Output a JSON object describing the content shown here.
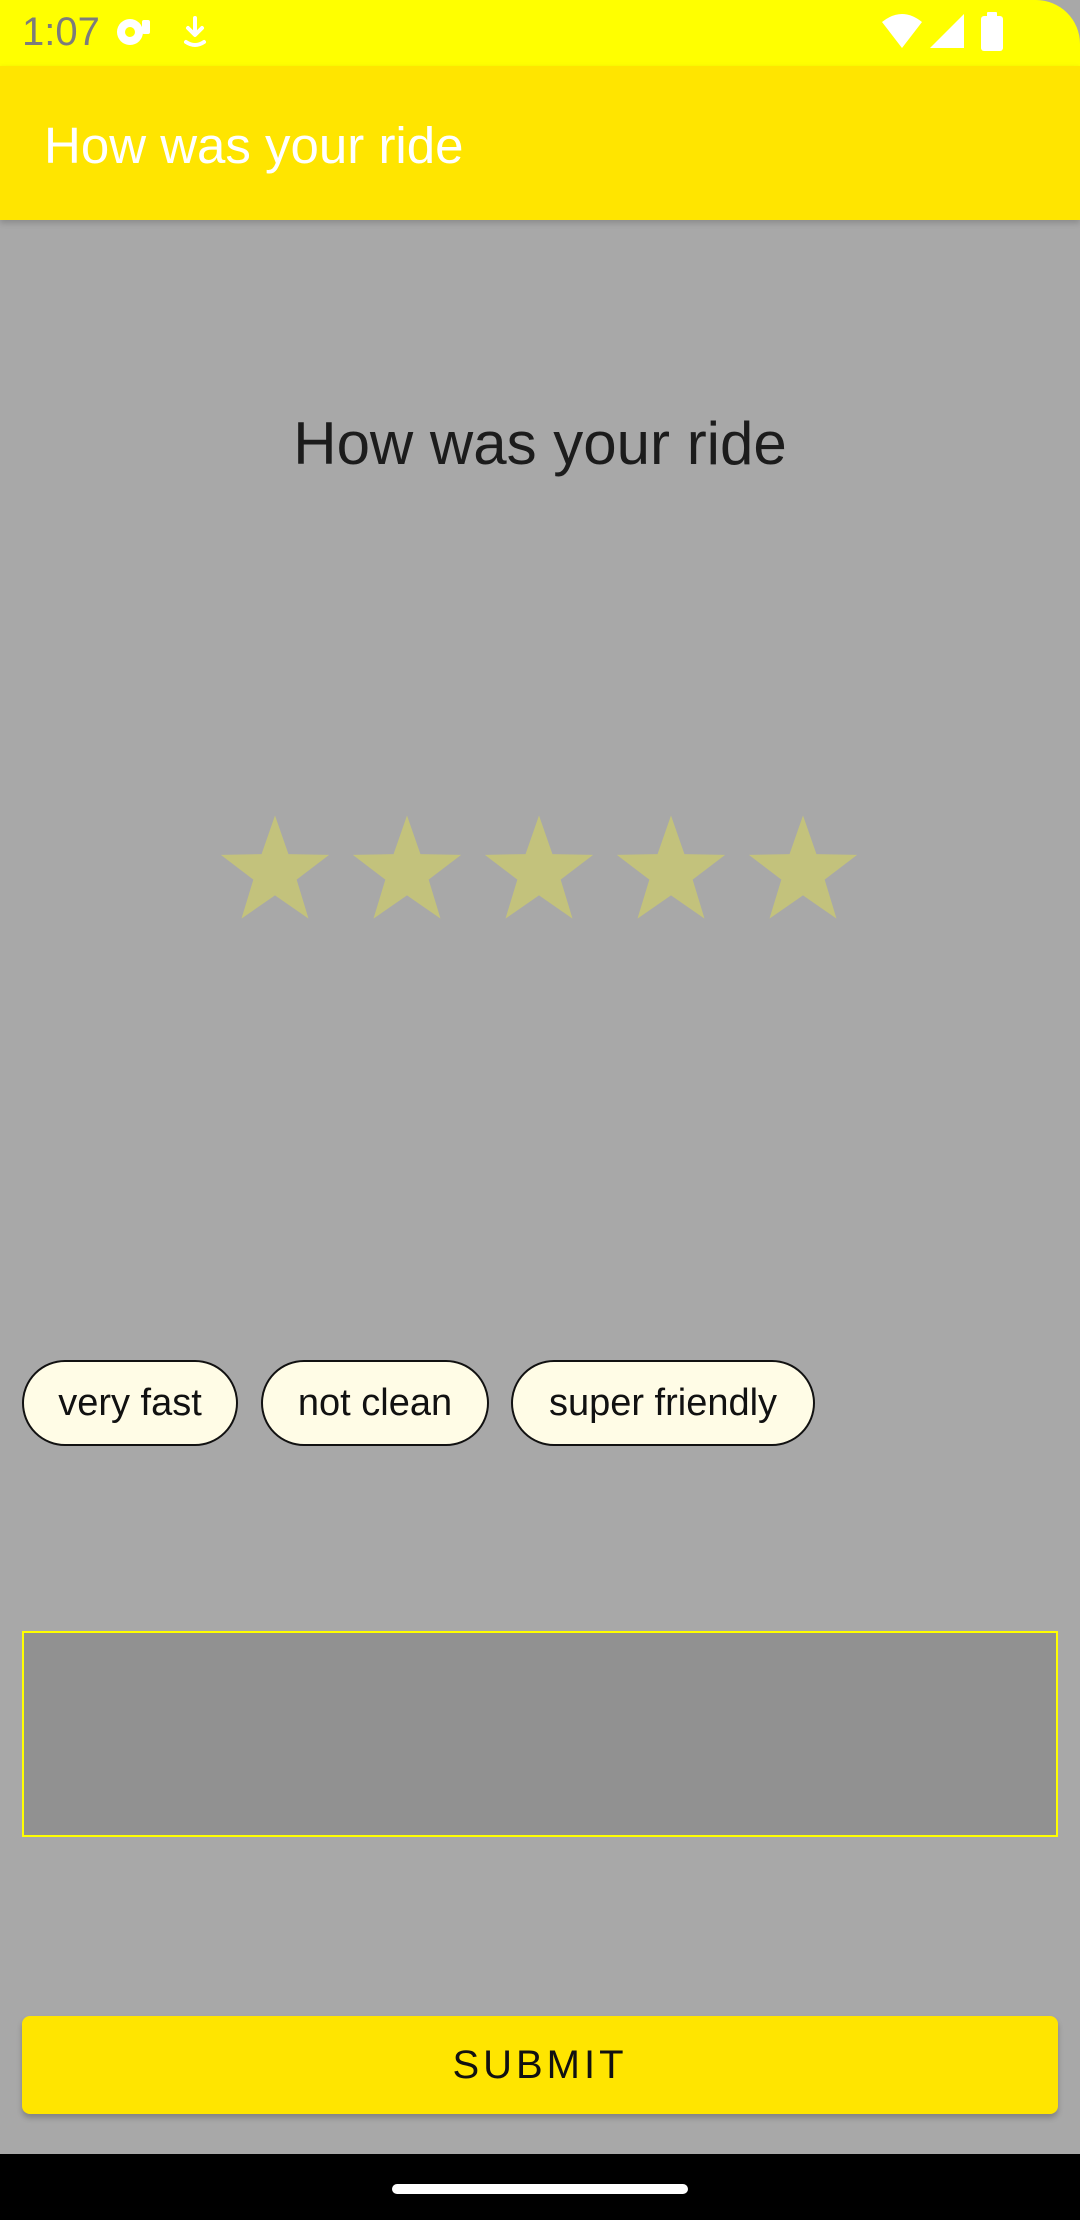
{
  "status_bar": {
    "time": "1:07",
    "background": "#ffff00",
    "icons": [
      "media-notification-icon",
      "download-notification-icon",
      "wifi-icon",
      "signal-icon",
      "battery-icon"
    ]
  },
  "app_bar": {
    "title": "How was your ride",
    "background": "#ffe500"
  },
  "main": {
    "heading": "How was your ride",
    "rating": {
      "max": 5,
      "value": 0,
      "star_color": "#c3c27c"
    },
    "chips": [
      {
        "label": "very fast"
      },
      {
        "label": "not clean"
      },
      {
        "label": "super friendly"
      }
    ],
    "comment": {
      "value": "",
      "border_color": "#ffff00"
    },
    "submit_label": "SUBMIT"
  },
  "nav_bar": {
    "background": "#000000"
  }
}
